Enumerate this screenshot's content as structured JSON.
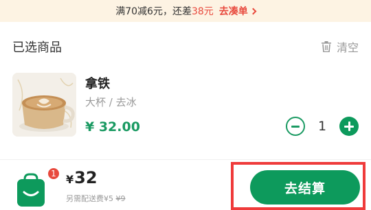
{
  "promo": {
    "prefix": "满70减6元，还差",
    "amount": "38元",
    "link_label": "去凑单"
  },
  "cart": {
    "title": "已选商品",
    "clear_label": "清空"
  },
  "item": {
    "name": "拿铁",
    "spec": "大杯 / 去冰",
    "price": "¥ 32.00",
    "quantity": "1",
    "icons": [
      "minus-icon",
      "plus-icon"
    ]
  },
  "summary": {
    "currency": "¥",
    "total": "32",
    "badge_count": "1",
    "delivery_prefix": "另需配送费¥5",
    "delivery_original": "¥9"
  },
  "checkout": {
    "label": "去结算"
  },
  "colors": {
    "brand_green": "#0d9a5c",
    "accent_red": "#e8493d",
    "highlight_border": "#ef3b3b",
    "promo_bg": "#fdf3e3"
  }
}
